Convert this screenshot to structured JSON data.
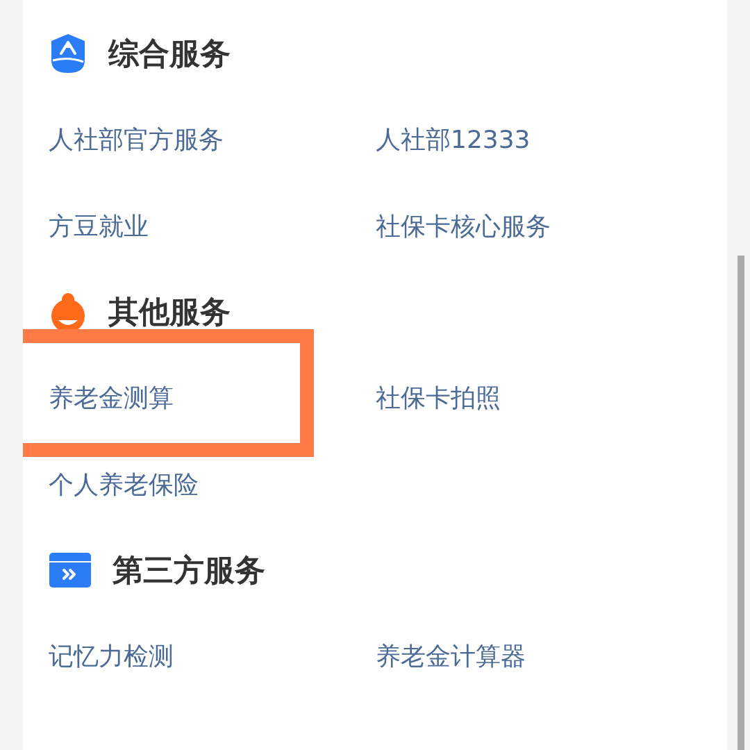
{
  "sections": [
    {
      "title": "综合服务",
      "kind": "shield",
      "items": [
        {
          "label": "人社部官方服务",
          "highlighted": false
        },
        {
          "label": "人社部12333",
          "highlighted": false
        },
        {
          "label": "方豆就业",
          "highlighted": false
        },
        {
          "label": "社保卡核心服务",
          "highlighted": false
        }
      ]
    },
    {
      "title": "其他服务",
      "kind": "person",
      "items": [
        {
          "label": "养老金测算",
          "highlighted": true
        },
        {
          "label": "社保卡拍照",
          "highlighted": false
        },
        {
          "label": "个人养老保险",
          "highlighted": false
        }
      ]
    },
    {
      "title": "第三方服务",
      "kind": "card",
      "items": [
        {
          "label": "记忆力检测",
          "highlighted": false
        },
        {
          "label": "养老金计算器",
          "highlighted": false
        }
      ]
    }
  ]
}
